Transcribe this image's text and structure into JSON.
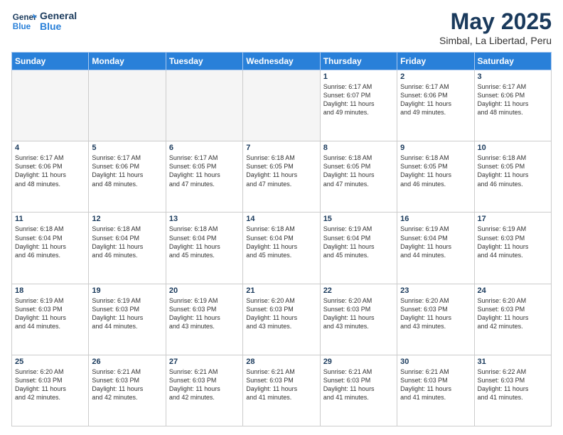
{
  "logo": {
    "line1": "General",
    "line2": "Blue"
  },
  "title": "May 2025",
  "subtitle": "Simbal, La Libertad, Peru",
  "days_of_week": [
    "Sunday",
    "Monday",
    "Tuesday",
    "Wednesday",
    "Thursday",
    "Friday",
    "Saturday"
  ],
  "weeks": [
    [
      {
        "day": "",
        "info": ""
      },
      {
        "day": "",
        "info": ""
      },
      {
        "day": "",
        "info": ""
      },
      {
        "day": "",
        "info": ""
      },
      {
        "day": "1",
        "info": "Sunrise: 6:17 AM\nSunset: 6:07 PM\nDaylight: 11 hours\nand 49 minutes."
      },
      {
        "day": "2",
        "info": "Sunrise: 6:17 AM\nSunset: 6:06 PM\nDaylight: 11 hours\nand 49 minutes."
      },
      {
        "day": "3",
        "info": "Sunrise: 6:17 AM\nSunset: 6:06 PM\nDaylight: 11 hours\nand 48 minutes."
      }
    ],
    [
      {
        "day": "4",
        "info": "Sunrise: 6:17 AM\nSunset: 6:06 PM\nDaylight: 11 hours\nand 48 minutes."
      },
      {
        "day": "5",
        "info": "Sunrise: 6:17 AM\nSunset: 6:06 PM\nDaylight: 11 hours\nand 48 minutes."
      },
      {
        "day": "6",
        "info": "Sunrise: 6:17 AM\nSunset: 6:05 PM\nDaylight: 11 hours\nand 47 minutes."
      },
      {
        "day": "7",
        "info": "Sunrise: 6:18 AM\nSunset: 6:05 PM\nDaylight: 11 hours\nand 47 minutes."
      },
      {
        "day": "8",
        "info": "Sunrise: 6:18 AM\nSunset: 6:05 PM\nDaylight: 11 hours\nand 47 minutes."
      },
      {
        "day": "9",
        "info": "Sunrise: 6:18 AM\nSunset: 6:05 PM\nDaylight: 11 hours\nand 46 minutes."
      },
      {
        "day": "10",
        "info": "Sunrise: 6:18 AM\nSunset: 6:05 PM\nDaylight: 11 hours\nand 46 minutes."
      }
    ],
    [
      {
        "day": "11",
        "info": "Sunrise: 6:18 AM\nSunset: 6:04 PM\nDaylight: 11 hours\nand 46 minutes."
      },
      {
        "day": "12",
        "info": "Sunrise: 6:18 AM\nSunset: 6:04 PM\nDaylight: 11 hours\nand 46 minutes."
      },
      {
        "day": "13",
        "info": "Sunrise: 6:18 AM\nSunset: 6:04 PM\nDaylight: 11 hours\nand 45 minutes."
      },
      {
        "day": "14",
        "info": "Sunrise: 6:18 AM\nSunset: 6:04 PM\nDaylight: 11 hours\nand 45 minutes."
      },
      {
        "day": "15",
        "info": "Sunrise: 6:19 AM\nSunset: 6:04 PM\nDaylight: 11 hours\nand 45 minutes."
      },
      {
        "day": "16",
        "info": "Sunrise: 6:19 AM\nSunset: 6:04 PM\nDaylight: 11 hours\nand 44 minutes."
      },
      {
        "day": "17",
        "info": "Sunrise: 6:19 AM\nSunset: 6:03 PM\nDaylight: 11 hours\nand 44 minutes."
      }
    ],
    [
      {
        "day": "18",
        "info": "Sunrise: 6:19 AM\nSunset: 6:03 PM\nDaylight: 11 hours\nand 44 minutes."
      },
      {
        "day": "19",
        "info": "Sunrise: 6:19 AM\nSunset: 6:03 PM\nDaylight: 11 hours\nand 44 minutes."
      },
      {
        "day": "20",
        "info": "Sunrise: 6:19 AM\nSunset: 6:03 PM\nDaylight: 11 hours\nand 43 minutes."
      },
      {
        "day": "21",
        "info": "Sunrise: 6:20 AM\nSunset: 6:03 PM\nDaylight: 11 hours\nand 43 minutes."
      },
      {
        "day": "22",
        "info": "Sunrise: 6:20 AM\nSunset: 6:03 PM\nDaylight: 11 hours\nand 43 minutes."
      },
      {
        "day": "23",
        "info": "Sunrise: 6:20 AM\nSunset: 6:03 PM\nDaylight: 11 hours\nand 43 minutes."
      },
      {
        "day": "24",
        "info": "Sunrise: 6:20 AM\nSunset: 6:03 PM\nDaylight: 11 hours\nand 42 minutes."
      }
    ],
    [
      {
        "day": "25",
        "info": "Sunrise: 6:20 AM\nSunset: 6:03 PM\nDaylight: 11 hours\nand 42 minutes."
      },
      {
        "day": "26",
        "info": "Sunrise: 6:21 AM\nSunset: 6:03 PM\nDaylight: 11 hours\nand 42 minutes."
      },
      {
        "day": "27",
        "info": "Sunrise: 6:21 AM\nSunset: 6:03 PM\nDaylight: 11 hours\nand 42 minutes."
      },
      {
        "day": "28",
        "info": "Sunrise: 6:21 AM\nSunset: 6:03 PM\nDaylight: 11 hours\nand 41 minutes."
      },
      {
        "day": "29",
        "info": "Sunrise: 6:21 AM\nSunset: 6:03 PM\nDaylight: 11 hours\nand 41 minutes."
      },
      {
        "day": "30",
        "info": "Sunrise: 6:21 AM\nSunset: 6:03 PM\nDaylight: 11 hours\nand 41 minutes."
      },
      {
        "day": "31",
        "info": "Sunrise: 6:22 AM\nSunset: 6:03 PM\nDaylight: 11 hours\nand 41 minutes."
      }
    ]
  ]
}
